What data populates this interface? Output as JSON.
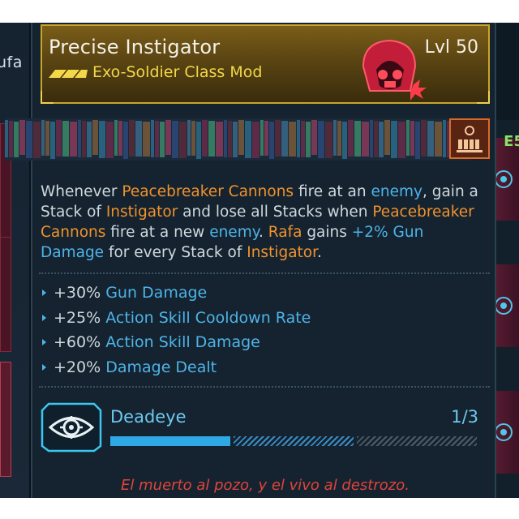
{
  "background": {
    "left_partial_text": "ufa",
    "right_partial_text": "E5"
  },
  "item": {
    "name": "Precise Instigator",
    "level": "Lvl 50",
    "type": "Exo-Soldier Class Mod",
    "rarity_color": "#c9a62a",
    "type_color": "#f3d84a"
  },
  "description": {
    "segments": [
      {
        "text": "Whenever ",
        "style": "plain"
      },
      {
        "text": "Peacebreaker Cannons",
        "style": "orange"
      },
      {
        "text": " fire at an ",
        "style": "plain"
      },
      {
        "text": "enemy",
        "style": "blue"
      },
      {
        "text": ", gain a Stack of ",
        "style": "plain"
      },
      {
        "text": "Instigator",
        "style": "orange"
      },
      {
        "text": " and lose all Stacks when ",
        "style": "plain"
      },
      {
        "text": "Peacebreaker Cannons",
        "style": "orange"
      },
      {
        "text": " fire at a new ",
        "style": "plain"
      },
      {
        "text": "enemy",
        "style": "blue"
      },
      {
        "text": ". ",
        "style": "plain"
      },
      {
        "text": "Rafa",
        "style": "orange"
      },
      {
        "text": " gains ",
        "style": "plain"
      },
      {
        "text": "+2% Gun Damage",
        "style": "blue"
      },
      {
        "text": " for every Stack of ",
        "style": "plain"
      },
      {
        "text": "Instigator",
        "style": "orange"
      },
      {
        "text": ".",
        "style": "plain"
      }
    ]
  },
  "stats": [
    {
      "value": "+30%",
      "name": "Gun Damage"
    },
    {
      "value": "+25%",
      "name": "Action Skill Cooldown Rate"
    },
    {
      "value": "+60%",
      "name": "Action Skill Damage"
    },
    {
      "value": "+20%",
      "name": "Damage Dealt"
    }
  ],
  "skill": {
    "name": "Deadeye",
    "rank": "1/3",
    "icon": "eye-target-icon",
    "current_points": 1,
    "max_points": 3
  },
  "flavor_text": "El muerto al pozo, y el vivo al destrozo.",
  "colors": {
    "highlight_orange": "#f0922e",
    "highlight_blue": "#4fb3e8",
    "flavor_red": "#e0443c",
    "panel_bg": "#14232f"
  }
}
